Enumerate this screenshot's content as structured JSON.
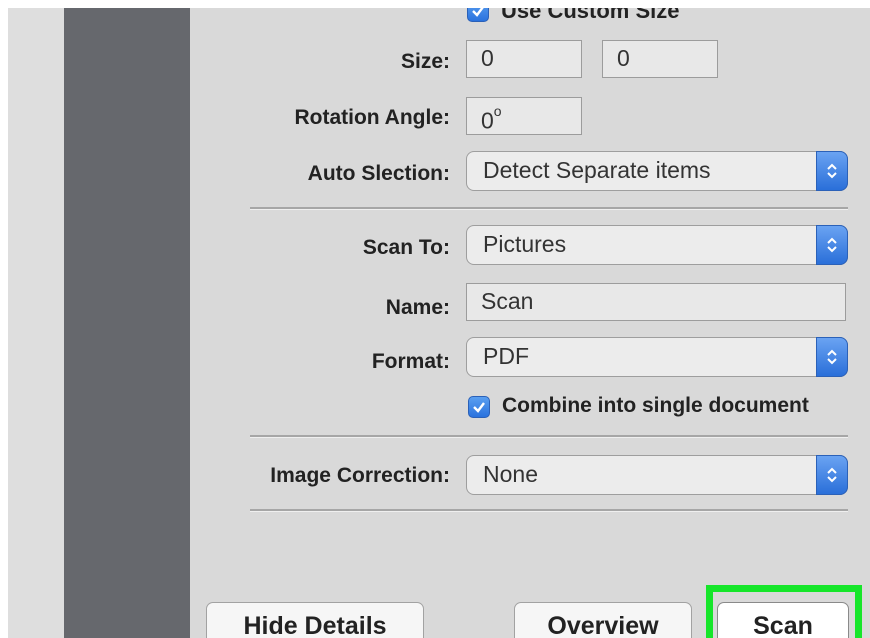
{
  "custom_size": {
    "label": "Use Custom Size",
    "checked": true
  },
  "size": {
    "label": "Size:",
    "width": "0",
    "height": "0"
  },
  "rotation": {
    "label": "Rotation Angle:",
    "value": "0o"
  },
  "auto_selection": {
    "label": "Auto Slection:",
    "value": "Detect Separate items"
  },
  "scan_to": {
    "label": "Scan To:",
    "value": "Pictures"
  },
  "name": {
    "label": "Name:",
    "value": "Scan"
  },
  "format": {
    "label": "Format:",
    "value": "PDF"
  },
  "combine": {
    "label": "Combine into single document",
    "checked": true
  },
  "image_correction": {
    "label": "Image Correction:",
    "value": "None"
  },
  "buttons": {
    "hide_details": "Hide Details",
    "overview": "Overview",
    "scan": "Scan"
  },
  "colors": {
    "accent": "#2a72de",
    "highlight": "#16e62a"
  }
}
